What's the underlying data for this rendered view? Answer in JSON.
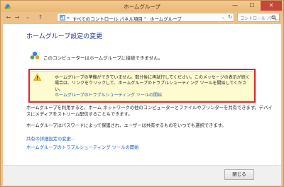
{
  "window": {
    "title": "ホームグループ",
    "minimize_label": "—",
    "maximize_label": "☐",
    "close_label": "✕"
  },
  "navigation": {
    "back_label": "←",
    "forward_label": "→",
    "history_label": "⌄",
    "up_label": "↑",
    "breadcrumb_sep_1": "«",
    "breadcrumb_1": "すべてのコントロール パネル項目",
    "breadcrumb_sep_2": "›",
    "breadcrumb_2": "ホームグループ",
    "dropdown_label": "⌄",
    "refresh_label": "↻",
    "search_placeholder": "コントロール パネ…"
  },
  "main": {
    "heading": "ホームグループ設定の変更",
    "status": "このコンピューターはホームグループに接続できません。",
    "warning": {
      "message": "ホームグループの準備ができていません。数分後に再試行してください。このメッセージの表示が続く場合は、リンクをクリックして、ホームグループのトラブルシューティング ツールを開始してください。",
      "link": "ホームグループのトラブルシューティング ツールの開始"
    },
    "para1": "ホームグループを利用すると、ホーム ネットワークの他のコンピューターとファイルやプリンターを共有できます。デバイスにメディアをストリーム配信することもできます。",
    "para2": "ホームグループはパスワードによって保護され、ユーザーは共有するものをいつでも選択できます。",
    "link_advanced": "共有の詳細設定の変更...",
    "link_troubleshoot": "ホームグループのトラブルシューティング ツールの開始"
  },
  "footer": {
    "close_button": "閉じる"
  }
}
